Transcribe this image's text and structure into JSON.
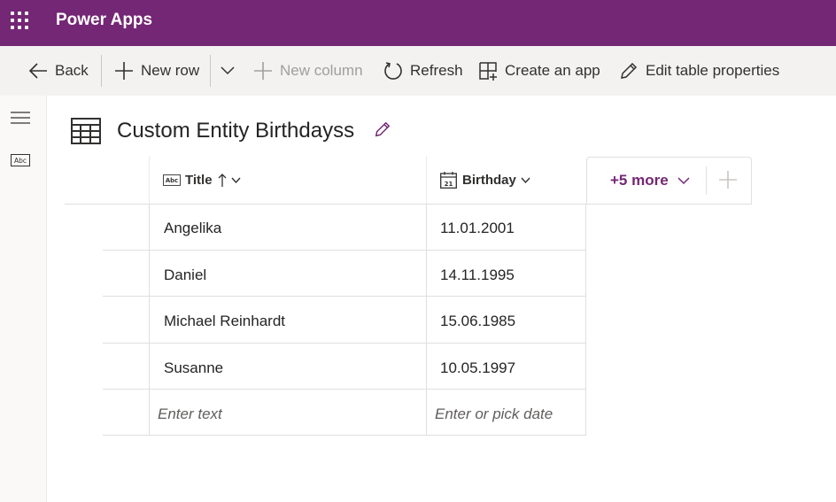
{
  "app": {
    "title": "Power Apps"
  },
  "commands": {
    "back": "Back",
    "new_row": "New row",
    "new_column": "New column",
    "refresh": "Refresh",
    "create_app": "Create an app",
    "edit_table": "Edit table properties"
  },
  "page": {
    "title": "Custom Entity Birthdayss"
  },
  "table": {
    "columns": [
      {
        "label": "Title",
        "icon": "text-field-icon",
        "sort": "ascending"
      },
      {
        "label": "Birthday",
        "icon": "calendar-icon"
      }
    ],
    "more_columns": "+5 more",
    "rows": [
      {
        "title": "Angelika",
        "birthday": "11.01.2001"
      },
      {
        "title": "Daniel",
        "birthday": "14.11.1995"
      },
      {
        "title": "Michael Reinhardt",
        "birthday": "15.06.1985"
      },
      {
        "title": "Susanne",
        "birthday": "10.05.1997"
      }
    ],
    "new_row_placeholders": {
      "title": "Enter text",
      "birthday": "Enter or pick date"
    }
  },
  "colors": {
    "brand": "#742774",
    "command_bar": "#f3f2f1"
  }
}
